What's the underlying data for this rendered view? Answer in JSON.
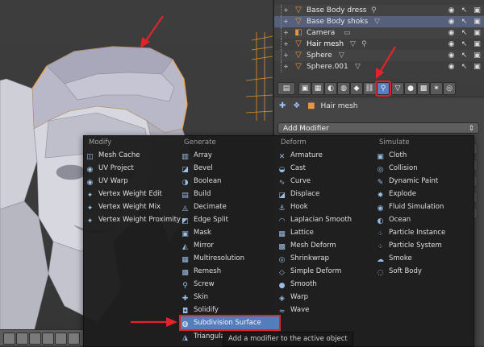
{
  "outliner": {
    "rows": [
      {
        "label": "Base Body dress",
        "icon": "armature-icon"
      },
      {
        "label": "Base Body shoks",
        "icon": "armature-icon"
      },
      {
        "label": "Camera",
        "icon": "camera-object-icon"
      },
      {
        "label": "Hair mesh",
        "icon": "mesh-object-icon"
      },
      {
        "label": "Sphere",
        "icon": "mesh-object-icon"
      },
      {
        "label": "Sphere.001",
        "icon": "mesh-object-icon"
      }
    ]
  },
  "properties": {
    "object_name": "Hair mesh",
    "add_modifier_label": "Add Modifier"
  },
  "menu": {
    "columns": [
      {
        "header": "Modify",
        "items": [
          {
            "label": "Mesh Cache",
            "icon": "mesh-cache-icon"
          },
          {
            "label": "UV Project",
            "icon": "uv-project-icon"
          },
          {
            "label": "UV Warp",
            "icon": "uv-warp-icon"
          },
          {
            "label": "Vertex Weight Edit",
            "icon": "vertex-weight-icon"
          },
          {
            "label": "Vertex Weight Mix",
            "icon": "vertex-weight-icon"
          },
          {
            "label": "Vertex Weight Proximity",
            "icon": "vertex-weight-icon"
          }
        ]
      },
      {
        "header": "Generate",
        "items": [
          {
            "label": "Array",
            "icon": "array-icon"
          },
          {
            "label": "Bevel",
            "icon": "bevel-icon"
          },
          {
            "label": "Boolean",
            "icon": "boolean-icon"
          },
          {
            "label": "Build",
            "icon": "build-icon"
          },
          {
            "label": "Decimate",
            "icon": "decimate-icon"
          },
          {
            "label": "Edge Split",
            "icon": "edge-split-icon"
          },
          {
            "label": "Mask",
            "icon": "mask-icon"
          },
          {
            "label": "Mirror",
            "icon": "mirror-icon"
          },
          {
            "label": "Multiresolution",
            "icon": "multires-icon"
          },
          {
            "label": "Remesh",
            "icon": "remesh-icon"
          },
          {
            "label": "Screw",
            "icon": "screw-icon"
          },
          {
            "label": "Skin",
            "icon": "skin-icon"
          },
          {
            "label": "Solidify",
            "icon": "solidify-icon"
          },
          {
            "label": "Subdivision Surface",
            "icon": "subsurf-icon"
          },
          {
            "label": "Triangula",
            "icon": "triangulate-icon"
          }
        ]
      },
      {
        "header": "Deform",
        "items": [
          {
            "label": "Armature",
            "icon": "armature-icon"
          },
          {
            "label": "Cast",
            "icon": "cast-icon"
          },
          {
            "label": "Curve",
            "icon": "curve-icon"
          },
          {
            "label": "Displace",
            "icon": "displace-icon"
          },
          {
            "label": "Hook",
            "icon": "hook-icon"
          },
          {
            "label": "Laplacian Smooth",
            "icon": "smooth-icon"
          },
          {
            "label": "Lattice",
            "icon": "lattice-icon"
          },
          {
            "label": "Mesh Deform",
            "icon": "mesh-deform-icon"
          },
          {
            "label": "Shrinkwrap",
            "icon": "shrinkwrap-icon"
          },
          {
            "label": "Simple Deform",
            "icon": "simple-deform-icon"
          },
          {
            "label": "Smooth",
            "icon": "smooth-icon"
          },
          {
            "label": "Warp",
            "icon": "warp-icon"
          },
          {
            "label": "Wave",
            "icon": "wave-icon"
          }
        ]
      },
      {
        "header": "Simulate",
        "items": [
          {
            "label": "Cloth",
            "icon": "cloth-icon"
          },
          {
            "label": "Collision",
            "icon": "collision-icon"
          },
          {
            "label": "Dynamic Paint",
            "icon": "dynamic-paint-icon"
          },
          {
            "label": "Explode",
            "icon": "explode-icon"
          },
          {
            "label": "Fluid Simulation",
            "icon": "fluid-icon"
          },
          {
            "label": "Ocean",
            "icon": "ocean-icon"
          },
          {
            "label": "Particle Instance",
            "icon": "particle-icon"
          },
          {
            "label": "Particle System",
            "icon": "particle-icon"
          },
          {
            "label": "Smoke",
            "icon": "smoke-icon"
          },
          {
            "label": "Soft Body",
            "icon": "soft-body-icon"
          }
        ]
      }
    ],
    "highlighted_item": "Subdivision Surface"
  },
  "tooltip": "Add a modifier to the active object",
  "colors": {
    "highlight": "#5680c2",
    "annotation": "#e0242c",
    "object_orange": "#e9973a"
  }
}
